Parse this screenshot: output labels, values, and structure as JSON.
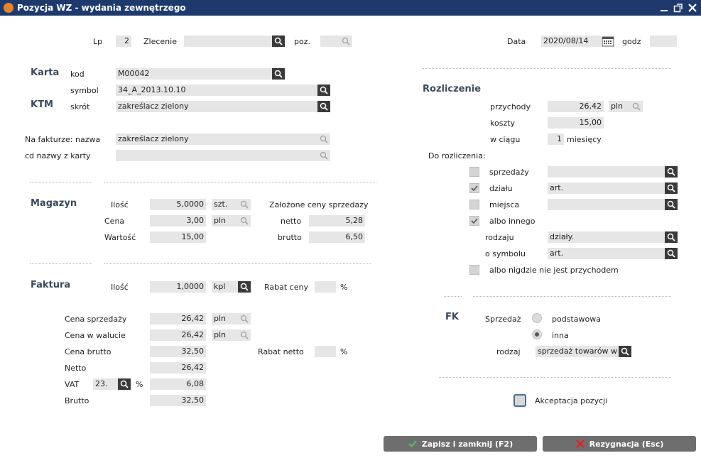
{
  "window": {
    "title": "Pozycja WZ - wydania zewnętrzego"
  },
  "header": {
    "lp_label": "Lp",
    "lp_value": "2",
    "zlecenie_label": "Zlecenie",
    "zlecenie_value": "",
    "poz_label": "poz.",
    "poz_value": "",
    "data_label": "Data",
    "data_value": "2020/08/14",
    "godz_label": "godz",
    "godz_value": ""
  },
  "karta": {
    "section": "Karta",
    "ktm_section": "KTM",
    "kod_label": "kod",
    "kod_value": "M00042",
    "symbol_label": "symbol",
    "symbol_value": "34_A_2013.10.10",
    "skrot_label": "skrót",
    "skrot_value": "zakreślacz zielony",
    "na_fakturze_label": "Na fakturze: nazwa",
    "na_fakturze_value": "zakreślacz zielony",
    "cd_label": "cd  nazwy z karty",
    "cd_value": ""
  },
  "magazyn": {
    "section": "Magazyn",
    "ilosc_label": "Ilość",
    "ilosc_value": "5,0000",
    "ilosc_unit": "szt.",
    "cena_label": "Cena",
    "cena_value": "3,00",
    "cena_unit": "pln",
    "wartosc_label": "Wartość",
    "wartosc_value": "15,00",
    "zalozone_label": "Założone ceny sprzedaży",
    "netto_label": "netto",
    "netto_value": "5,28",
    "brutto_label": "brutto",
    "brutto_value": "6,50"
  },
  "faktura": {
    "section": "Faktura",
    "ilosc_label": "Ilość",
    "ilosc_value": "1,0000",
    "ilosc_unit": "kpl",
    "rabat_ceny_label": "Rabat ceny",
    "rabat_ceny_value": "",
    "pct1": "%",
    "cena_sprzedazy_label": "Cena sprzedaży",
    "cena_sprzedazy_value": "26,42",
    "cena_sprzedazy_unit": "pln",
    "cena_waluta_label": "Cena w walucie",
    "cena_waluta_value": "26,42",
    "cena_waluta_unit": "pln",
    "cena_brutto_label": "Cena brutto",
    "cena_brutto_value": "32,50",
    "rabat_netto_label": "Rabat netto",
    "rabat_netto_value": "",
    "pct2": "%",
    "netto_label": "Netto",
    "netto_value": "26,42",
    "vat_label": "VAT",
    "vat_rate": "23.",
    "vat_pct": "%",
    "vat_value": "6,08",
    "brutto_label": "Brutto",
    "brutto_value": "32,50"
  },
  "rozliczenie": {
    "section": "Rozliczenie",
    "przychody_label": "przychody",
    "przychody_value": "26,42",
    "przychody_unit": "pln",
    "koszty_label": "koszty",
    "koszty_value": "15,00",
    "w_ciagu_label": "w ciągu",
    "w_ciagu_value": "1",
    "miesiecy_label": "miesięcy",
    "do_rozliczenia_label": "Do rozliczenia:",
    "sprzedazy_label": "sprzedaży",
    "sprzedazy_value": "",
    "sprzedazy_checked": false,
    "dzialu_label": "działu",
    "dzialu_value": "art.",
    "dzialu_checked": true,
    "miejsca_label": "miejsca",
    "miejsca_value": "",
    "miejsca_checked": false,
    "albo_innego_label": "albo innego",
    "albo_innego_checked": true,
    "rodzaju_label": "rodzaju",
    "rodzaju_value": "działy.",
    "o_symbolu_label": "o symbolu",
    "o_symbolu_value": "art.",
    "albo_nigdzie_label": "albo nigdzie nie jest przychodem",
    "albo_nigdzie_checked": false
  },
  "fk": {
    "section": "FK",
    "sprzedaz_label": "Sprzedaż",
    "podstawowa_label": "podstawowa",
    "inna_label": "inna",
    "selected": "inna",
    "rodzaj_label": "rodzaj",
    "rodzaj_value": "sprzedaż towarów w k"
  },
  "akceptacja_label": "Akceptacja pozycji",
  "buttons": {
    "save_label": "Zapisz i zamknij (F2)",
    "cancel_label": "Rezygnacja (Esc)"
  },
  "colors": {
    "titlebar": "#1e3a6d",
    "field_bg": "#e6e6e6",
    "search_btn": "#3a3a3a",
    "save_check": "#5cb85c",
    "cancel_x": "#e02020"
  }
}
